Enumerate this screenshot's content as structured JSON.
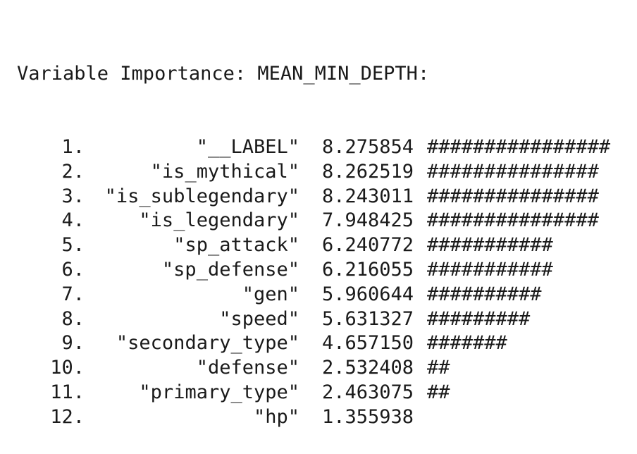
{
  "header": {
    "title": "Variable Importance: MEAN_MIN_DEPTH:"
  },
  "rows": [
    {
      "rank": "1.",
      "name": "\"__LABEL\"",
      "value": "8.275854",
      "bar": "################"
    },
    {
      "rank": "2.",
      "name": "\"is_mythical\"",
      "value": "8.262519",
      "bar": "###############"
    },
    {
      "rank": "3.",
      "name": "\"is_sublegendary\"",
      "value": "8.243011",
      "bar": "###############"
    },
    {
      "rank": "4.",
      "name": "\"is_legendary\"",
      "value": "7.948425",
      "bar": "###############"
    },
    {
      "rank": "5.",
      "name": "\"sp_attack\"",
      "value": "6.240772",
      "bar": "###########"
    },
    {
      "rank": "6.",
      "name": "\"sp_defense\"",
      "value": "6.216055",
      "bar": "###########"
    },
    {
      "rank": "7.",
      "name": "\"gen\"",
      "value": "5.960644",
      "bar": "##########"
    },
    {
      "rank": "8.",
      "name": "\"speed\"",
      "value": "5.631327",
      "bar": "#########"
    },
    {
      "rank": "9.",
      "name": "\"secondary_type\"",
      "value": "4.657150",
      "bar": "#######"
    },
    {
      "rank": "10.",
      "name": "\"defense\"",
      "value": "2.532408",
      "bar": "##"
    },
    {
      "rank": "11.",
      "name": "\"primary_type\"",
      "value": "2.463075",
      "bar": "##"
    },
    {
      "rank": "12.",
      "name": "\"hp\"",
      "value": "1.355938",
      "bar": ""
    }
  ]
}
